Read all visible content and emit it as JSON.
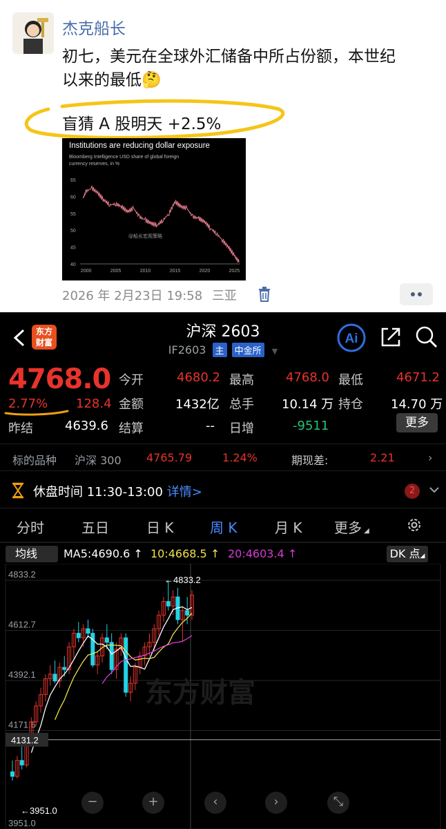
{
  "post": {
    "author": "杰克船长",
    "text_line1": "初七，美元在全球外汇储备中所占份额，本世纪",
    "text_line2": "以来的最低",
    "emoji": "🤔",
    "text_line3": "盲猜 A 股明天 +2.5%",
    "timestamp": "2026 年 2月23日 19:58",
    "location": "三亚",
    "highlight_color": "#f5c518",
    "image": {
      "chart_data": {
        "type": "line",
        "title": "Institutions are reducing dollar exposure",
        "subtitle": "Bloomberg Intelligence USD share of global foreign currency reserves, in %",
        "watermark": "@船长宏观策略",
        "x_ticks": [
          "2000",
          "2005",
          "2010",
          "2015",
          "2020",
          "2025"
        ],
        "y_ticks": [
          40,
          45,
          50,
          55,
          60,
          65
        ],
        "ylim": [
          40,
          65
        ],
        "xlim": [
          1999,
          2026
        ],
        "series": [
          {
            "color": "#e77c8e",
            "x": [
              1999.5,
              2000,
              2001,
              2002,
              2003,
              2004,
              2005,
              2006,
              2007,
              2008,
              2009,
              2010,
              2011,
              2012,
              2013,
              2014,
              2015,
              2016,
              2017,
              2018,
              2019,
              2020,
              2021,
              2022,
              2023,
              2024,
              2025,
              2025.8
            ],
            "y": [
              59.5,
              61.5,
              62.5,
              61.0,
              59.0,
              57.5,
              57.8,
              57.0,
              55.5,
              56.5,
              54.0,
              53.0,
              52.0,
              51.5,
              53.0,
              55.0,
              58.5,
              57.0,
              56.5,
              54.0,
              53.5,
              52.5,
              50.5,
              49.0,
              47.0,
              45.0,
              42.5,
              40.5
            ]
          }
        ]
      }
    }
  },
  "app": {
    "logo_text_1": "东方",
    "logo_text_2": "财富",
    "title": "沪深 2603",
    "code": "IF2603",
    "tag_main": "主",
    "tag_exchange": "中金所",
    "price": "4768.0",
    "change_pct": "2.77%",
    "change_abs": "128.4",
    "prev_close_label": "昨结",
    "prev_close": "4639.6",
    "fields": {
      "open_label": "今开",
      "open": "4680.2",
      "high_label": "最高",
      "high": "4768.0",
      "low_label": "最低",
      "low": "4671.2",
      "amount_label": "金额",
      "amount": "1432亿",
      "volume_label": "总手",
      "volume": "10.14 万",
      "oi_label": "持仓",
      "oi": "14.70 万",
      "settle_label": "结算",
      "settle": "--",
      "daily_inc_label": "日增",
      "daily_inc": "-9511"
    },
    "more_label": "更多",
    "ref": {
      "label": "标的品种",
      "name": "沪深 300",
      "value": "4765.79",
      "pct": "1.24%",
      "basis_label": "期现差:",
      "basis": "2.21"
    },
    "notice": {
      "text": "休盘时间 11:30-13:00",
      "link": "详情",
      "link_arrow": ">",
      "badge": "2"
    },
    "tabs": [
      "分时",
      "五日",
      "日 K",
      "周 K",
      "月 K",
      "更多"
    ],
    "active_tab": "周 K",
    "ma": {
      "selector": "均线",
      "ma5": "MA5:4690.6 ↑",
      "ma10": "10:4668.5 ↑",
      "ma20": "20:4603.4 ↑",
      "dk": "DK 点"
    },
    "chart_data": {
      "type": "candlestick",
      "y_ticks": [
        "4833.2",
        "4612.7",
        "4392.1",
        "4171.6"
      ],
      "cursor_label": "4131.2",
      "high_label": "←4833.2",
      "low_label": "←3951.0",
      "bottom_label": "3951.0",
      "watermark": "东方财富",
      "ylim": [
        3951,
        4833.2
      ],
      "colors": {
        "up": "#e8332c",
        "down": "#22d3e6",
        "ma5": "#ffffff",
        "ma10": "#f1e24b",
        "ma20": "#d63ad6"
      },
      "candles": [
        {
          "o": 3990,
          "h": 4040,
          "l": 3951,
          "c": 3970
        },
        {
          "o": 3970,
          "h": 4060,
          "l": 3960,
          "c": 4040
        },
        {
          "o": 4040,
          "h": 4110,
          "l": 4000,
          "c": 4020
        },
        {
          "o": 4020,
          "h": 4150,
          "l": 4010,
          "c": 4130
        },
        {
          "o": 4130,
          "h": 4230,
          "l": 4110,
          "c": 4210
        },
        {
          "o": 4210,
          "h": 4300,
          "l": 4190,
          "c": 4280
        },
        {
          "o": 4280,
          "h": 4360,
          "l": 4250,
          "c": 4330
        },
        {
          "o": 4330,
          "h": 4420,
          "l": 4300,
          "c": 4400
        },
        {
          "o": 4400,
          "h": 4460,
          "l": 4370,
          "c": 4420
        },
        {
          "o": 4420,
          "h": 4480,
          "l": 4380,
          "c": 4390
        },
        {
          "o": 4390,
          "h": 4470,
          "l": 4360,
          "c": 4450
        },
        {
          "o": 4450,
          "h": 4500,
          "l": 4410,
          "c": 4440
        },
        {
          "o": 4440,
          "h": 4560,
          "l": 4420,
          "c": 4540
        },
        {
          "o": 4540,
          "h": 4620,
          "l": 4490,
          "c": 4600
        },
        {
          "o": 4600,
          "h": 4650,
          "l": 4560,
          "c": 4580
        },
        {
          "o": 4580,
          "h": 4640,
          "l": 4540,
          "c": 4620
        },
        {
          "o": 4620,
          "h": 4660,
          "l": 4580,
          "c": 4600
        },
        {
          "o": 4600,
          "h": 4620,
          "l": 4450,
          "c": 4460
        },
        {
          "o": 4460,
          "h": 4520,
          "l": 4420,
          "c": 4500
        },
        {
          "o": 4500,
          "h": 4600,
          "l": 4470,
          "c": 4580
        },
        {
          "o": 4580,
          "h": 4640,
          "l": 4530,
          "c": 4560
        },
        {
          "o": 4560,
          "h": 4600,
          "l": 4420,
          "c": 4440
        },
        {
          "o": 4440,
          "h": 4560,
          "l": 4400,
          "c": 4530
        },
        {
          "o": 4530,
          "h": 4600,
          "l": 4500,
          "c": 4580
        },
        {
          "o": 4580,
          "h": 4600,
          "l": 4320,
          "c": 4340
        },
        {
          "o": 4340,
          "h": 4410,
          "l": 4300,
          "c": 4380
        },
        {
          "o": 4380,
          "h": 4470,
          "l": 4350,
          "c": 4450
        },
        {
          "o": 4450,
          "h": 4520,
          "l": 4420,
          "c": 4500
        },
        {
          "o": 4500,
          "h": 4560,
          "l": 4460,
          "c": 4540
        },
        {
          "o": 4540,
          "h": 4600,
          "l": 4500,
          "c": 4560
        },
        {
          "o": 4560,
          "h": 4640,
          "l": 4520,
          "c": 4620
        },
        {
          "o": 4620,
          "h": 4700,
          "l": 4590,
          "c": 4680
        },
        {
          "o": 4680,
          "h": 4760,
          "l": 4650,
          "c": 4740
        },
        {
          "o": 4740,
          "h": 4833.2,
          "l": 4700,
          "c": 4720
        },
        {
          "o": 4720,
          "h": 4790,
          "l": 4680,
          "c": 4760
        },
        {
          "o": 4760,
          "h": 4800,
          "l": 4640,
          "c": 4660
        },
        {
          "o": 4660,
          "h": 4720,
          "l": 4560,
          "c": 4700
        },
        {
          "o": 4700,
          "h": 4760,
          "l": 4640,
          "c": 4680
        },
        {
          "o": 4680,
          "h": 4790,
          "l": 4660,
          "c": 4768
        }
      ]
    },
    "controls": [
      "−",
      "+",
      "‹",
      "›",
      "⤡"
    ]
  }
}
